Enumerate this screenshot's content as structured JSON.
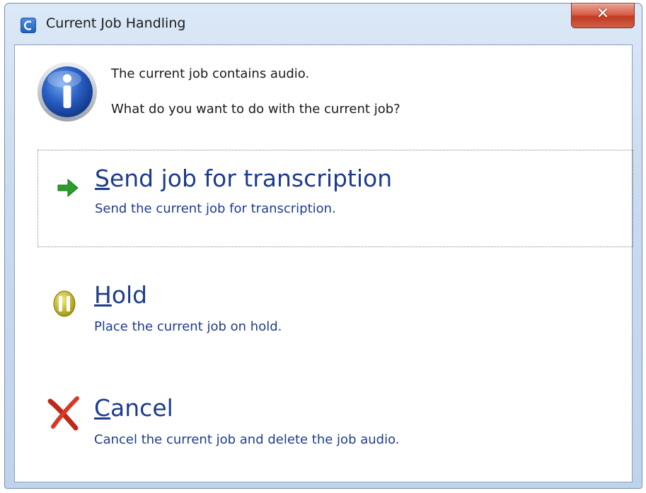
{
  "window": {
    "title": "Current Job Handling",
    "close_label": "✕"
  },
  "message": {
    "line1": "The current job contains audio.",
    "line2": "What do you want to do with the current job?",
    "icon": "information-icon"
  },
  "options": [
    {
      "access_key": "S",
      "title_rest": "end job for transcription",
      "description": "Send the current job for transcription.",
      "icon": "green-arrow-icon",
      "focused": true
    },
    {
      "access_key": "H",
      "title_rest": "old",
      "description": "Place the current job on hold.",
      "icon": "pause-icon",
      "focused": false
    },
    {
      "access_key": "C",
      "title_rest": "ancel",
      "description": "Cancel the current job and delete the job audio.",
      "icon": "red-x-icon",
      "focused": false
    }
  ],
  "colors": {
    "link_text": "#1e3c8c",
    "close_button": "#c13a22",
    "arrow_green": "#2a9d2a",
    "pause_yellow": "#c8b81e",
    "cancel_red": "#c0281a"
  }
}
